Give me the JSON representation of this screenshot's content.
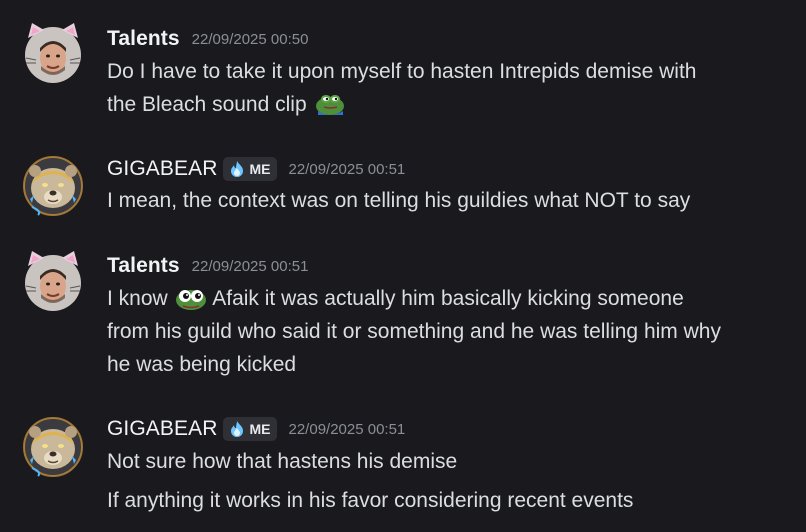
{
  "messages": [
    {
      "username": "Talents",
      "timestamp": "22/09/2025 00:50",
      "lines": [
        "Do I have to take it upon myself to hasten Intrepids demise with",
        "the Bleach sound clip"
      ]
    },
    {
      "username": "GIGABEAR",
      "badge": "ME",
      "timestamp": "22/09/2025 00:51",
      "lines": [
        "I mean, the context was on telling his guildies what NOT to say"
      ]
    },
    {
      "username": "Talents",
      "timestamp": "22/09/2025 00:51",
      "lines": [
        "I know",
        "Afaik it was actually him basically kicking someone",
        "from his guild who said it or something and he was telling him why",
        "he was being kicked"
      ]
    },
    {
      "username": "GIGABEAR",
      "badge": "ME",
      "timestamp": "22/09/2025 00:51",
      "lines": [
        "Not sure how that hastens his demise",
        "If anything it works in his favor considering recent events"
      ]
    }
  ],
  "icons": {
    "talents_avatar": "cat-ear-avatar-icon",
    "gigabear_avatar": "bear-avatar-icon",
    "badge_icon": "flame-badge-icon",
    "emoji_1": "pepe-frog-emoji-icon",
    "emoji_2": "pepe-frog-eyes-emoji-icon"
  },
  "colors": {
    "background": "#1a1a1e",
    "text": "#dbdee1",
    "timestamp": "#8b8e96",
    "badge_bg": "#2e3036"
  }
}
